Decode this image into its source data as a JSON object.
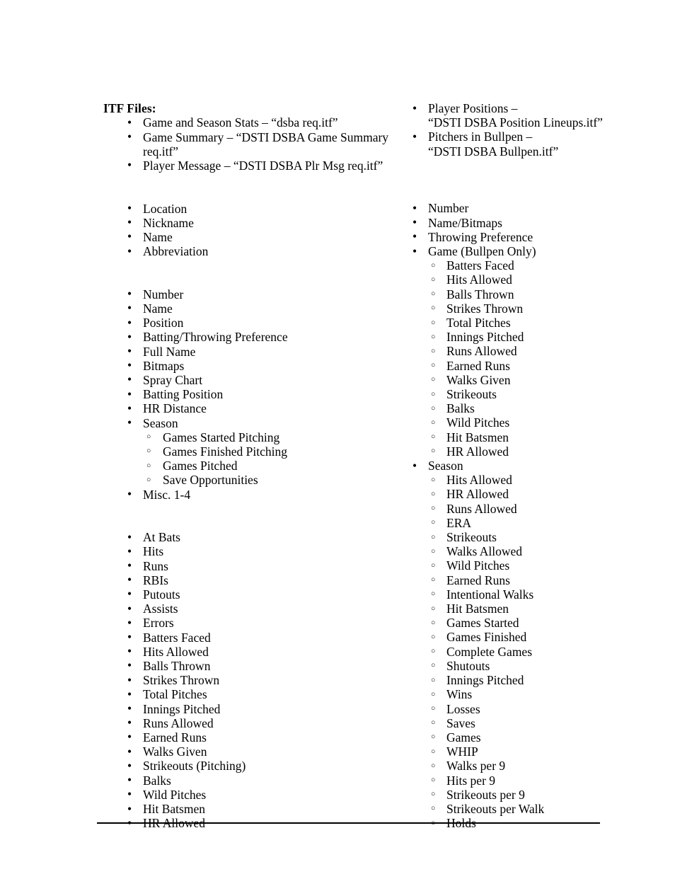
{
  "document": {
    "heading": "ITF Files:",
    "itf_files_left": [
      "Game and Season Stats – “dsba req.itf”",
      "Game Summary – “DSTI DSBA Game Summary req.itf”",
      "Player Message – “DSTI DSBA Plr Msg req.itf”"
    ],
    "itf_files_right": [
      {
        "line1": "Player Positions –",
        "line2": "“DSTI DSBA Position Lineups.itf”"
      },
      {
        "line1": "Pitchers in Bullpen –",
        "line2": "“DSTI DSBA Bullpen.itf”"
      }
    ],
    "left_column": {
      "team_fields": [
        "Location",
        "Nickname",
        "Name",
        "Abbreviation"
      ],
      "player_fields": [
        "Number",
        "Name",
        "Position",
        "Batting/Throwing Preference",
        "Full Name",
        "Bitmaps",
        "Spray Chart",
        "Batting Position",
        "HR Distance"
      ],
      "season_label": "Season",
      "season_sub": [
        "Games Started Pitching",
        "Games Finished Pitching",
        "Games Pitched",
        "Save Opportunities"
      ],
      "misc_label": "Misc. 1-4",
      "game_stats": [
        "At Bats",
        "Hits",
        "Runs",
        "RBIs",
        "Putouts",
        "Assists",
        "Errors",
        "Batters Faced",
        "Hits Allowed",
        "Balls Thrown",
        "Strikes Thrown",
        "Total Pitches",
        "Innings Pitched",
        "Runs Allowed",
        "Earned Runs",
        "Walks Given",
        "Strikeouts (Pitching)",
        "Balks",
        "Wild Pitches",
        "Hit Batsmen",
        "HR Allowed"
      ]
    },
    "right_column": {
      "bullpen_fields": [
        "Number",
        "Name/Bitmaps",
        "Throwing Preference"
      ],
      "game_label": "Game (Bullpen Only)",
      "game_sub": [
        "Batters Faced",
        "Hits Allowed",
        "Balls Thrown",
        "Strikes Thrown",
        "Total Pitches",
        "Innings Pitched",
        "Runs Allowed",
        "Earned Runs",
        "Walks Given",
        "Strikeouts",
        "Balks",
        "Wild Pitches",
        "Hit Batsmen",
        "HR Allowed"
      ],
      "season_label": "Season",
      "season_sub": [
        "Hits Allowed",
        "HR Allowed",
        "Runs Allowed",
        "ERA",
        "Strikeouts",
        "Walks Allowed",
        "Wild Pitches",
        "Earned Runs",
        "Intentional Walks",
        "Hit Batsmen",
        "Games Started",
        "Games Finished",
        "Complete Games",
        "Shutouts",
        "Innings Pitched",
        "Wins",
        "Losses",
        "Saves",
        "Games",
        "WHIP",
        "Walks per 9",
        "Hits per 9",
        "Strikeouts per 9",
        "Strikeouts per Walk",
        "Holds"
      ]
    }
  }
}
